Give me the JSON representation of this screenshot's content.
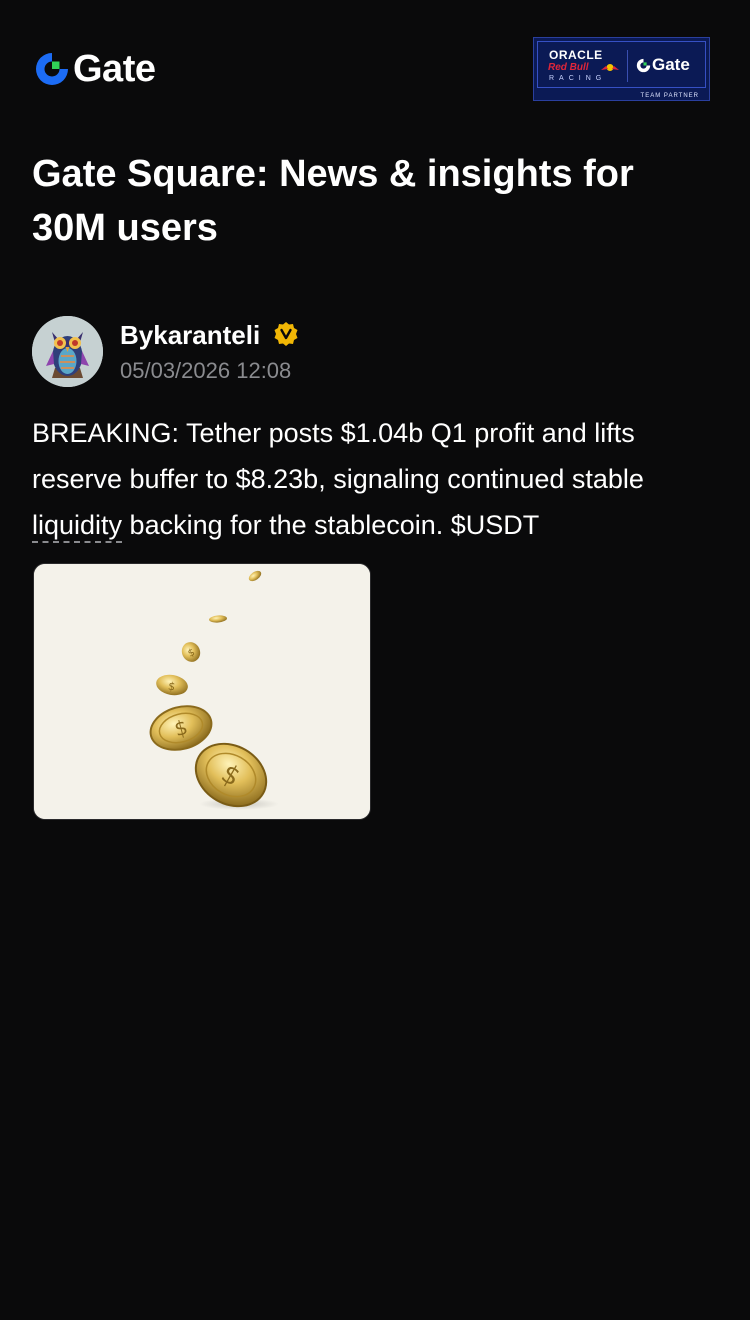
{
  "header": {
    "logo_text": "Gate",
    "partner": {
      "oracle": "ORACLE",
      "redbull": "Red Bull",
      "racing": "RACING",
      "gate": "Gate",
      "team_partner": "TEAM PARTNER"
    }
  },
  "page": {
    "title": "Gate Square: News & insights for 30M users"
  },
  "post": {
    "author": "Bykaranteli",
    "timestamp": "05/03/2026 12:08",
    "body_before": "BREAKING: Tether posts $1.04b Q1 profit and lifts reserve buffer to $8.23b, signaling continued stable ",
    "body_link": "liquidity",
    "body_after": " backing for the stablecoin. $USDT",
    "image_icon": "gold-coins-falling-image"
  },
  "colors": {
    "background": "#0a0a0b",
    "brand_blue": "#1c6cf5",
    "brand_green": "#30d158",
    "muted_text": "#8a8b8f",
    "verified_gold": "#f2b705"
  }
}
